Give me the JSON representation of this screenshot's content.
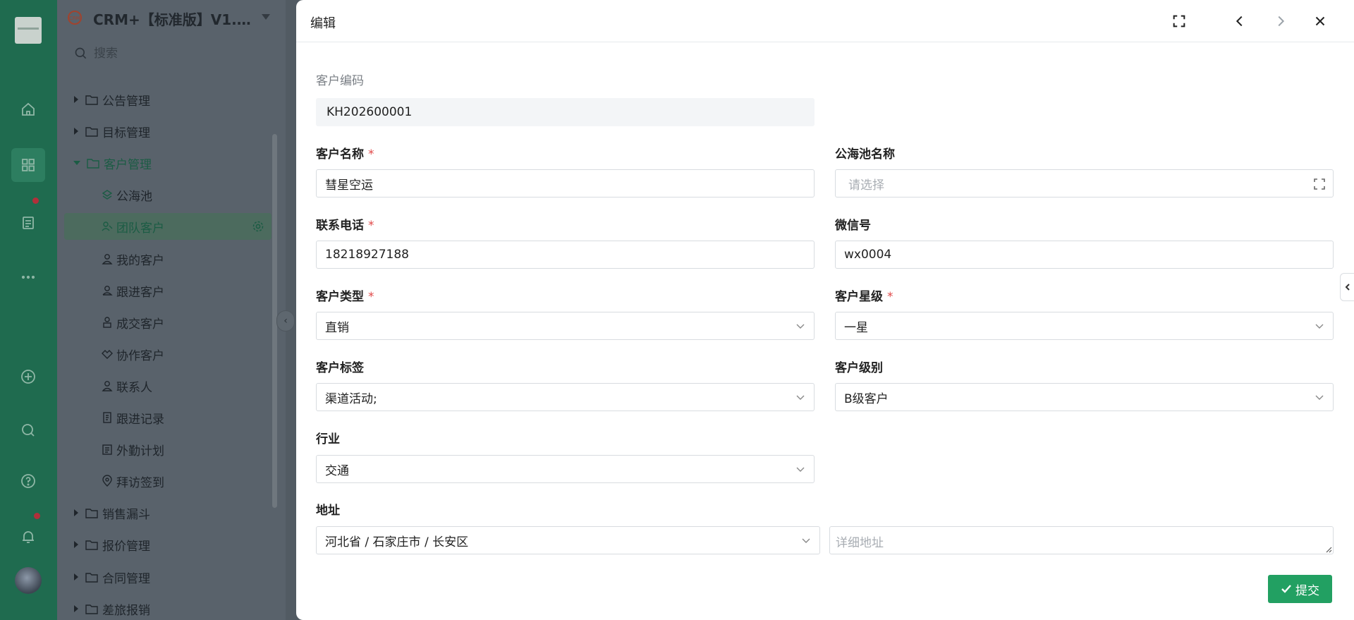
{
  "rail": {
    "items": [
      "home",
      "apps",
      "document",
      "more",
      "add",
      "search",
      "help",
      "notifications"
    ]
  },
  "tree": {
    "app_title": "CRM+【标准版】V1.0…",
    "search_placeholder": "搜索",
    "items": [
      {
        "label": "公告管理",
        "level": 0,
        "state": "collapsed"
      },
      {
        "label": "目标管理",
        "level": 0,
        "state": "collapsed"
      },
      {
        "label": "客户管理",
        "level": 0,
        "state": "expanded"
      },
      {
        "label": "公海池",
        "level": 1,
        "icon": "pool-icon"
      },
      {
        "label": "团队客户",
        "level": 1,
        "icon": "team-customer-icon",
        "selected": true
      },
      {
        "label": "我的客户",
        "level": 1,
        "icon": "user-icon"
      },
      {
        "label": "跟进客户",
        "level": 1,
        "icon": "follow-user-icon"
      },
      {
        "label": "成交客户",
        "level": 1,
        "icon": "deal-user-icon"
      },
      {
        "label": "协作客户",
        "level": 1,
        "icon": "handshake-icon"
      },
      {
        "label": "联系人",
        "level": 1,
        "icon": "contact-icon"
      },
      {
        "label": "跟进记录",
        "level": 1,
        "icon": "record-icon"
      },
      {
        "label": "外勤计划",
        "level": 1,
        "icon": "plan-icon"
      },
      {
        "label": "拜访签到",
        "level": 1,
        "icon": "location-icon"
      },
      {
        "label": "销售漏斗",
        "level": 0,
        "state": "collapsed"
      },
      {
        "label": "报价管理",
        "level": 0,
        "state": "collapsed"
      },
      {
        "label": "合同管理",
        "level": 0,
        "state": "collapsed"
      },
      {
        "label": "差旅报销",
        "level": 0,
        "state": "collapsed"
      }
    ]
  },
  "drawer": {
    "title": "编辑",
    "submit_label": "提交",
    "fields": {
      "customer_code": {
        "label": "客户编码",
        "value": "KH202600001"
      },
      "customer_name": {
        "label": "客户名称",
        "required": "*",
        "value": "彗星空运"
      },
      "pool_name": {
        "label": "公海池名称",
        "placeholder": "请选择"
      },
      "phone": {
        "label": "联系电话",
        "required": "*",
        "value": "18218927188"
      },
      "wechat": {
        "label": "微信号",
        "value": "wx0004"
      },
      "customer_type": {
        "label": "客户类型",
        "required": "*",
        "value": "直销"
      },
      "customer_star": {
        "label": "客户星级",
        "required": "*",
        "value": "一星"
      },
      "customer_tag": {
        "label": "客户标签",
        "value": "渠道活动;"
      },
      "customer_level": {
        "label": "客户级别",
        "value": "B级客户"
      },
      "industry": {
        "label": "行业",
        "value": "交通"
      },
      "address": {
        "label": "地址",
        "region": "河北省 / 石家庄市 / 长安区",
        "detail_placeholder": "详细地址"
      }
    }
  },
  "colors": {
    "rail": "#1f6b4f",
    "primary": "#22a062",
    "required": "#e04848"
  }
}
